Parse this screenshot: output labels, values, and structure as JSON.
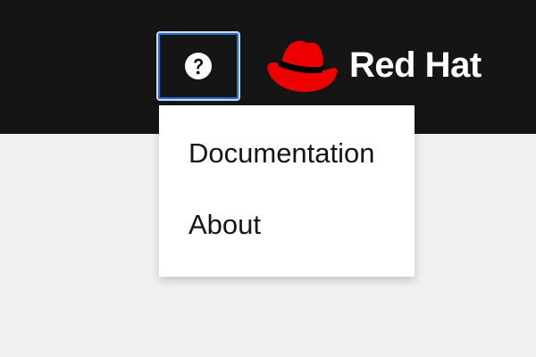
{
  "header": {
    "help_button": {
      "icon": "question-circle-icon"
    },
    "brand": {
      "logo_icon": "red-hat-fedora-icon",
      "text": "Red Hat"
    }
  },
  "help_menu": {
    "items": [
      {
        "label": "Documentation"
      },
      {
        "label": "About"
      }
    ]
  },
  "colors": {
    "header_background": "#151515",
    "page_background": "#f0f0f0",
    "menu_background": "#ffffff",
    "focus_ring": "#2b6fd6",
    "brand_red": "#ee0000",
    "text_dark": "#151515",
    "text_light": "#ffffff"
  }
}
